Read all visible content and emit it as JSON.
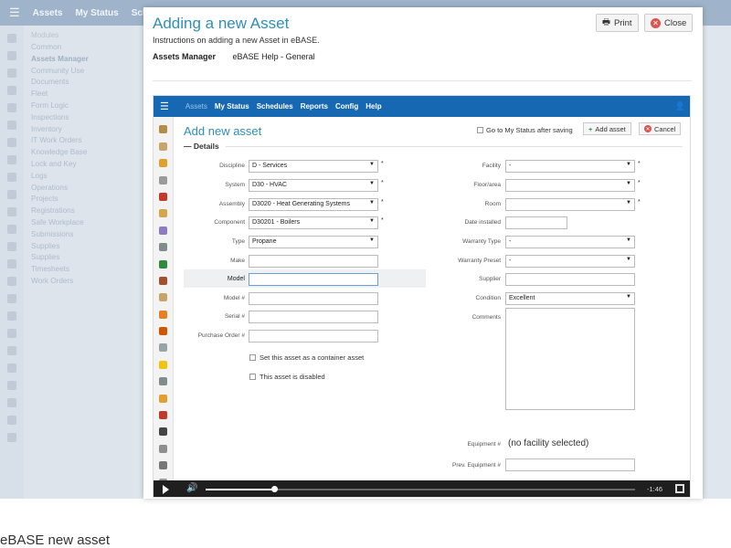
{
  "background_app": {
    "nav": [
      "Assets",
      "My Status",
      "Sche"
    ],
    "menu_heading": "Modules",
    "menu_items": [
      "Common",
      "Assets Manager",
      "Community Use",
      "Documents",
      "Fleet",
      "Form Logic",
      "Inspections",
      "Inventory",
      "IT Work Orders",
      "Knowledge Base",
      "Lock and Key",
      "Logs",
      "Operations",
      "Projects",
      "Registrations",
      "Safe Workplace",
      "Submissions",
      "Supplies",
      "Supplies",
      "Timesheets",
      "Work Orders"
    ]
  },
  "modal": {
    "title": "Adding a new Asset",
    "subtitle": "Instructions on adding a new Asset in eBASE.",
    "breadcrumb_module": "Assets Manager",
    "breadcrumb_section": "eBASE Help - General",
    "print_label": "Print",
    "close_label": "Close"
  },
  "video": {
    "nav": {
      "active": "Assets",
      "items": [
        "My Status",
        "Schedules",
        "Reports",
        "Config",
        "Help"
      ]
    },
    "page_title": "Add new asset",
    "go_to_status_label": "Go to My Status after saving",
    "add_asset_label": "Add asset",
    "cancel_label": "Cancel",
    "section": "Details",
    "left_fields": [
      {
        "label": "Discipline",
        "value": "D - Services",
        "dropdown": true,
        "required": true
      },
      {
        "label": "System",
        "value": "D30 - HVAC",
        "dropdown": true,
        "required": true
      },
      {
        "label": "Assembly",
        "value": "D3020 - Heat Generating Systems",
        "dropdown": true,
        "required": true
      },
      {
        "label": "Component",
        "value": "D30201 - Boilers",
        "dropdown": true,
        "required": true
      },
      {
        "label": "Type",
        "value": "Propane",
        "dropdown": true,
        "required": false
      },
      {
        "label": "Make",
        "value": "",
        "dropdown": false,
        "required": false
      },
      {
        "label": "Model",
        "value": "",
        "dropdown": false,
        "required": false
      },
      {
        "label": "Model #",
        "value": "",
        "dropdown": false,
        "required": false
      },
      {
        "label": "Serial #",
        "value": "",
        "dropdown": false,
        "required": false
      },
      {
        "label": "Purchase Order #",
        "value": "",
        "dropdown": false,
        "required": false
      }
    ],
    "container_label": "Set this asset as a container asset",
    "disabled_label": "This asset is disabled",
    "right_fields": [
      {
        "label": "Facility",
        "value": "-",
        "dropdown": true,
        "required": true
      },
      {
        "label": "Floor/area",
        "value": "",
        "dropdown": true,
        "required": true
      },
      {
        "label": "Room",
        "value": "",
        "dropdown": true,
        "required": true
      },
      {
        "label": "Date installed",
        "value": "",
        "dropdown": false,
        "required": false
      },
      {
        "label": "Warranty Type",
        "value": "-",
        "dropdown": true,
        "required": false
      },
      {
        "label": "Warranty Preset",
        "value": "-",
        "dropdown": true,
        "required": false
      },
      {
        "label": "Supplier",
        "value": "",
        "dropdown": false,
        "required": false
      },
      {
        "label": "Condition",
        "value": "Excellent",
        "dropdown": true,
        "required": false
      }
    ],
    "comments_label": "Comments",
    "equipment_label": "Equipment #",
    "equipment_value": "(no facility selected)",
    "prev_equipment_label": "Prev. Equipment #",
    "time": "-1:46",
    "progress": 0.16
  },
  "caption": "eBASE new asset",
  "colors": {
    "accent": "#2e8fb5",
    "nav_blue": "#1668b3",
    "add_green": "#2e8b3d",
    "cancel_red": "#d9534f"
  }
}
